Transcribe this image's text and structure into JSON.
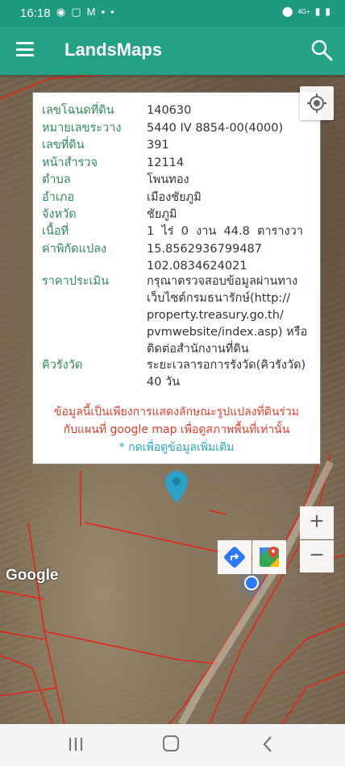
{
  "status_bar": {
    "time": "16:18",
    "left_icons": [
      "line-icon",
      "message-icon",
      "gmail-icon",
      "chat-icon",
      "dot-icon"
    ],
    "network": "4G+",
    "right_icons": [
      "location-icon",
      "signal-icon",
      "battery-icon"
    ]
  },
  "app_bar": {
    "title": "LandsMaps",
    "menu_icon": "hamburger-icon",
    "search_icon": "search-icon"
  },
  "info": {
    "rows": [
      {
        "label": "เลขโฉนดที่ดิน",
        "value": "140630"
      },
      {
        "label": "หมายเลขระวาง",
        "value": "5440 IV 8854-00(4000)"
      },
      {
        "label": "เลขที่ดิน",
        "value": "391"
      },
      {
        "label": "หน้าสำรวจ",
        "value": "12114"
      },
      {
        "label": "ตำบล",
        "value": "โพนทอง"
      },
      {
        "label": "อำเภอ",
        "value": "เมืองชัยภูมิ"
      },
      {
        "label": "จังหวัด",
        "value": "ชัยภูมิ"
      },
      {
        "label": "เนื้อที่",
        "value": "1  ไร่  0  งาน  44.8  ตารางวา"
      },
      {
        "label": "ค่าพิกัดแปลง",
        "value": "15.8562936799487",
        "value2": "102.0834624021"
      },
      {
        "label": "ราคาประเมิน",
        "value": "กรุณาตรวจสอบข้อมูลผ่านทาง",
        "value2": "เว็บไซต์กรมธนารักษ์(http://",
        "value3": "property.treasury.go.th/",
        "value4": "pvmwebsite/index.asp) หรือ",
        "value5": "ติดต่อสำนักงานที่ดิน"
      },
      {
        "label": "คิวรังวัด",
        "value": "ระยะเวลารอการรังวัด(คิวรังวัด)",
        "value2": "40 วัน"
      }
    ],
    "warning_line1": "ข้อมูลนี้เป็นเพียงการแสดงลักษณะรูปแปลงที่ดินร่วม",
    "warning_line2": "กับแผนที่ google map เพื่อดูสภาพพื้นที่เท่านั้น",
    "more_link": "* กดเพื่อดูข้อมูลเพิ่มเติม"
  },
  "map": {
    "attribution": "Google",
    "zoom_in": "+",
    "zoom_out": "−",
    "parcel_color": "#e8231a",
    "marker_color": "#2ba0c9",
    "my_location_color": "#2979ff"
  },
  "nav_bar": {
    "icons": [
      "recents-icon",
      "home-icon",
      "back-icon"
    ]
  }
}
